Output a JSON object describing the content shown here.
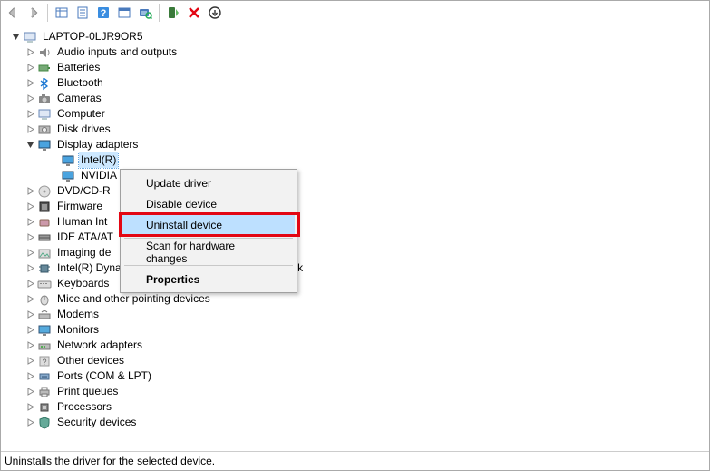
{
  "root": {
    "label": "LAPTOP-0LJR9OR5"
  },
  "categories": [
    {
      "key": "audio",
      "label": "Audio inputs and outputs",
      "icon": "audio",
      "expanded": false
    },
    {
      "key": "batteries",
      "label": "Batteries",
      "icon": "battery",
      "expanded": false
    },
    {
      "key": "bluetooth",
      "label": "Bluetooth",
      "icon": "bluetooth",
      "expanded": false
    },
    {
      "key": "cameras",
      "label": "Cameras",
      "icon": "camera",
      "expanded": false
    },
    {
      "key": "computer",
      "label": "Computer",
      "icon": "computer",
      "expanded": false
    },
    {
      "key": "diskdrives",
      "label": "Disk drives",
      "icon": "disk",
      "expanded": false
    },
    {
      "key": "display",
      "label": "Display adapters",
      "icon": "display",
      "expanded": true
    },
    {
      "key": "dvdcd",
      "label": "DVD/CD-R",
      "icon": "dvd",
      "expanded": false,
      "truncated": true
    },
    {
      "key": "firmware",
      "label": "Firmware",
      "icon": "firmware",
      "expanded": false,
      "truncated": true
    },
    {
      "key": "humanint",
      "label": "Human Int",
      "icon": "hid",
      "expanded": false,
      "truncated": true
    },
    {
      "key": "ideata",
      "label": "IDE ATA/AT",
      "icon": "ide",
      "expanded": false,
      "truncated": true
    },
    {
      "key": "imaging",
      "label": "Imaging de",
      "icon": "imaging",
      "expanded": false,
      "truncated": true
    },
    {
      "key": "dpt",
      "label": "Intel(R) Dynamic Platform and Thermal Framework",
      "icon": "chip",
      "expanded": false
    },
    {
      "key": "keyboards",
      "label": "Keyboards",
      "icon": "keyboard",
      "expanded": false
    },
    {
      "key": "mice",
      "label": "Mice and other pointing devices",
      "icon": "mouse",
      "expanded": false
    },
    {
      "key": "modems",
      "label": "Modems",
      "icon": "modem",
      "expanded": false
    },
    {
      "key": "monitors",
      "label": "Monitors",
      "icon": "monitor",
      "expanded": false
    },
    {
      "key": "network",
      "label": "Network adapters",
      "icon": "network",
      "expanded": false
    },
    {
      "key": "other",
      "label": "Other devices",
      "icon": "other",
      "expanded": false
    },
    {
      "key": "ports",
      "label": "Ports (COM & LPT)",
      "icon": "port",
      "expanded": false
    },
    {
      "key": "printq",
      "label": "Print queues",
      "icon": "printer",
      "expanded": false
    },
    {
      "key": "processors",
      "label": "Processors",
      "icon": "cpu",
      "expanded": false
    },
    {
      "key": "security",
      "label": "Security devices",
      "icon": "security",
      "expanded": false
    }
  ],
  "display_children": [
    {
      "key": "intel",
      "label": "Intel(R)",
      "icon": "display",
      "selected": true
    },
    {
      "key": "nvidia",
      "label": "NVIDIA",
      "icon": "display",
      "selected": false
    }
  ],
  "context_menu": {
    "items": [
      {
        "key": "update",
        "label": "Update driver",
        "hover": false
      },
      {
        "key": "disable",
        "label": "Disable device",
        "hover": false
      },
      {
        "key": "uninstall",
        "label": "Uninstall device",
        "hover": true,
        "highlighted": true
      },
      {
        "key": "sep1",
        "separator": true
      },
      {
        "key": "scan",
        "label": "Scan for hardware changes",
        "hover": false
      },
      {
        "key": "sep2",
        "separator": true
      },
      {
        "key": "props",
        "label": "Properties",
        "hover": false,
        "bold": true
      }
    ]
  },
  "status": "Uninstalls the driver for the selected device.",
  "colors": {
    "highlight_red": "#e30613",
    "selection_blue": "#cde8ff",
    "menu_hover": "#bde0ff"
  }
}
